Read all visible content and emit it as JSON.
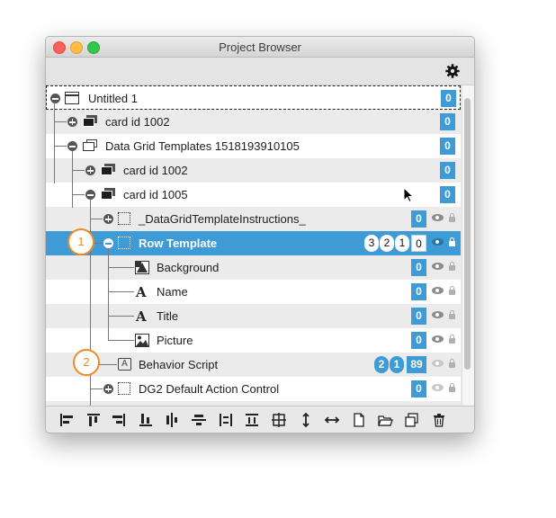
{
  "window": {
    "title": "Project Browser"
  },
  "toolbar": {
    "settings_icon": "gear-icon"
  },
  "tree": {
    "rows": [
      {
        "label": "Untitled 1",
        "count": "0"
      },
      {
        "label": "card id 1002",
        "count": "0"
      },
      {
        "label": "Data Grid Templates 1518193910105",
        "count": "0"
      },
      {
        "label": "card id 1002",
        "count": "0"
      },
      {
        "label": "card id 1005",
        "count": "0"
      },
      {
        "label": "_DataGridTemplateInstructions_",
        "count": "0"
      },
      {
        "label": "Row Template",
        "count": "0",
        "pills": [
          "3",
          "2",
          "1"
        ]
      },
      {
        "label": "Background",
        "count": "0"
      },
      {
        "label": "Name",
        "count": "0"
      },
      {
        "label": "Title",
        "count": "0"
      },
      {
        "label": "Picture",
        "count": "0"
      },
      {
        "label": "Behavior Script",
        "count": "89",
        "pills": [
          "2",
          "1"
        ]
      },
      {
        "label": "DG2 Default Action Control",
        "count": "0"
      }
    ]
  },
  "icons": {
    "text_glyph": "A",
    "boxed_glyph": "A"
  },
  "callouts": [
    "1",
    "2"
  ],
  "bottom_toolbar": [
    "align-left-icon",
    "align-top-icon",
    "align-right-icon",
    "align-bottom-icon",
    "align-center-h-icon",
    "align-center-v-icon",
    "distribute-h-icon",
    "distribute-v-icon",
    "fit-icon",
    "equal-height-icon",
    "equal-width-icon",
    "new-file-icon",
    "open-folder-icon",
    "duplicate-icon",
    "trash-icon"
  ],
  "colors": {
    "selection": "#3e9bd6",
    "callout": "#f08a24"
  }
}
